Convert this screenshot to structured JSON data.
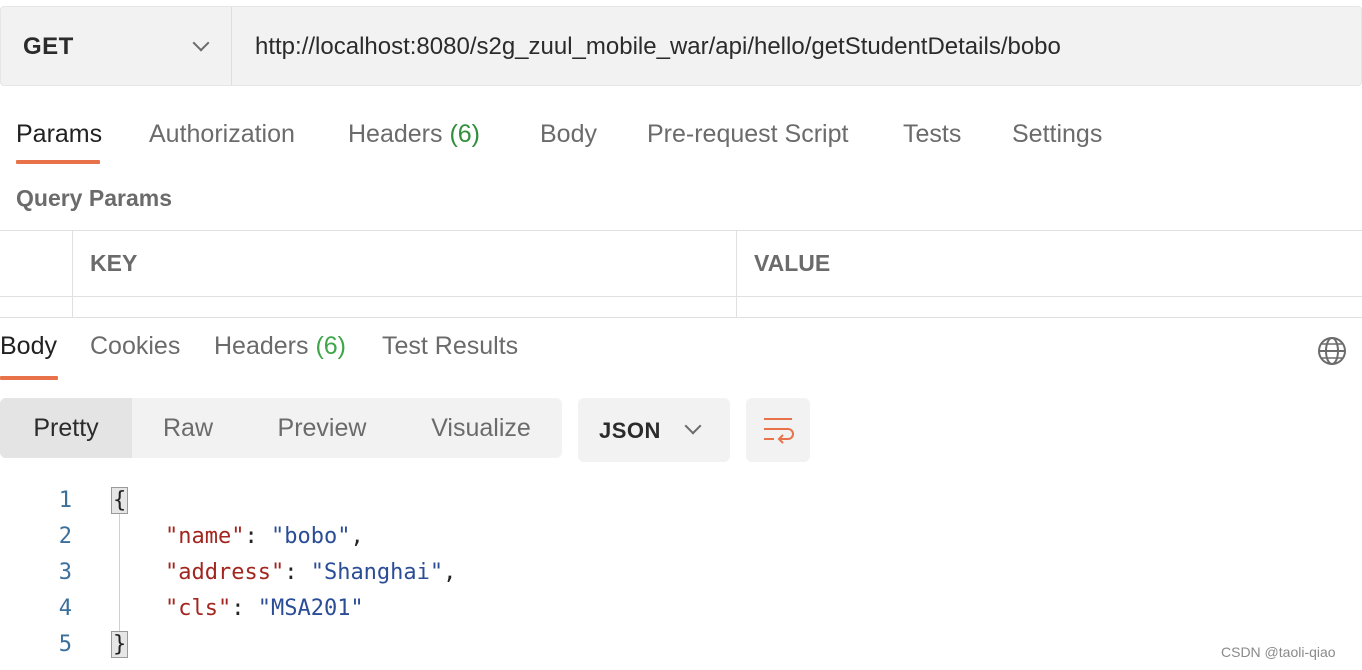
{
  "request": {
    "method": "GET",
    "url": "http://localhost:8080/s2g_zuul_mobile_war/api/hello/getStudentDetails/bobo"
  },
  "request_tabs": {
    "params": "Params",
    "authorization": "Authorization",
    "headers": "Headers",
    "headers_count": "(6)",
    "body": "Body",
    "prerequest": "Pre-request Script",
    "tests": "Tests",
    "settings": "Settings"
  },
  "query_params": {
    "title": "Query Params",
    "col_key": "KEY",
    "col_value": "VALUE"
  },
  "response_tabs": {
    "body": "Body",
    "cookies": "Cookies",
    "headers": "Headers",
    "headers_count": "(6)",
    "test_results": "Test Results"
  },
  "view_modes": {
    "pretty": "Pretty",
    "raw": "Raw",
    "preview": "Preview",
    "visualize": "Visualize"
  },
  "format": "JSON",
  "code": {
    "line_numbers": [
      "1",
      "2",
      "3",
      "4",
      "5"
    ],
    "open_brace": "{",
    "close_brace": "}",
    "lines": [
      {
        "key": "\"name\"",
        "value": "\"bobo\"",
        "trail": ","
      },
      {
        "key": "\"address\"",
        "value": "\"Shanghai\"",
        "trail": ","
      },
      {
        "key": "\"cls\"",
        "value": "\"MSA201\"",
        "trail": ""
      }
    ]
  },
  "watermark": "CSDN @taoli-qiao",
  "colors": {
    "accent": "#e8724a",
    "count_green": "#2f8f3b",
    "json_key": "#a2261f",
    "json_string": "#2a4d96"
  },
  "icons": [
    "chevron-down-icon",
    "globe-icon",
    "wrap-lines-icon"
  ]
}
